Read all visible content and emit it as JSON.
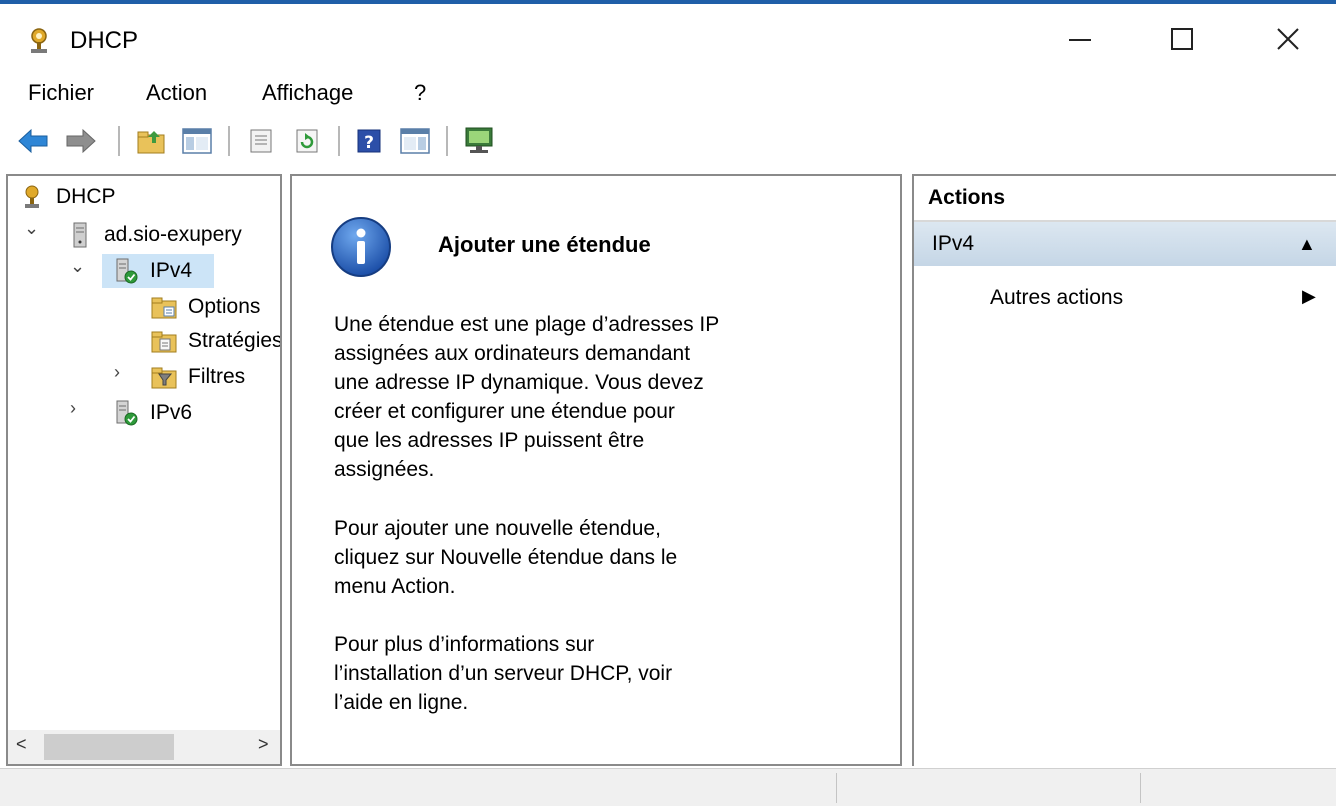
{
  "window": {
    "title": "DHCP",
    "minimize_glyph": "—",
    "maximize_glyph": "☐",
    "close_glyph": "✕"
  },
  "menu": [
    {
      "label": "Fichier"
    },
    {
      "label": "Action"
    },
    {
      "label": "Affichage"
    },
    {
      "label": "?"
    }
  ],
  "toolbar": {
    "icons": [
      "back-arrow-icon",
      "forward-arrow-icon",
      "up-folder-icon",
      "show-hide-tree-icon",
      "properties-icon",
      "refresh-icon",
      "help-icon",
      "show-hide-action-pane-icon",
      "monitor-icon"
    ]
  },
  "tree": {
    "root": "DHCP",
    "server": "ad.sio-exupery",
    "ipv4": "IPv4",
    "options": "Options",
    "strategies": "Stratégies",
    "filters": "Filtres",
    "ipv6": "IPv6",
    "chevron_expanded": "⌄",
    "chevron_collapsed": "›"
  },
  "main": {
    "heading": "Ajouter une étendue",
    "para1": [
      "Une étendue est une plage d’adresses IP",
      "assignées aux ordinateurs demandant",
      "une adresse IP dynamique. Vous devez",
      "créer et configurer une étendue pour",
      "que les adresses IP puissent être",
      "assignées."
    ],
    "para2": [
      "Pour ajouter une nouvelle étendue,",
      "cliquez sur Nouvelle étendue dans le",
      "menu Action."
    ],
    "para3": [
      "Pour plus d’informations sur",
      "l’installation d’un serveur DHCP, voir",
      "l’aide en ligne."
    ]
  },
  "actions": {
    "title": "Actions",
    "section": "IPv4",
    "collapse_glyph": "▲",
    "item": "Autres actions",
    "item_arrow": "▶"
  },
  "scrollbar": {
    "left": "<",
    "right": ">"
  },
  "colors": {
    "selection": "#cce4f7",
    "accent": "#1f5fa8"
  }
}
